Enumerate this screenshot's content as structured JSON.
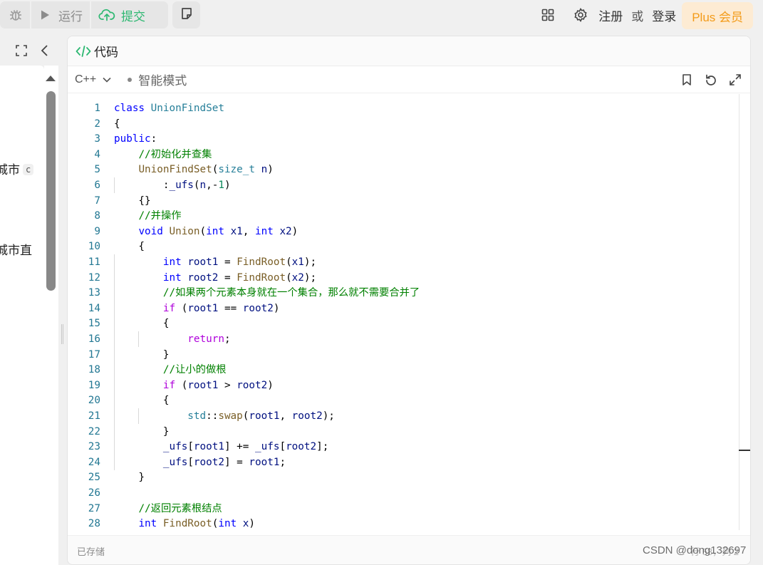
{
  "toolbar": {
    "run_label": "运行",
    "submit_label": "提交"
  },
  "header": {
    "register": "注册",
    "or": "或",
    "login": "登录",
    "plus": "Plus 会员"
  },
  "left_panel": {
    "snippet1": "城市",
    "snippet1_tag": "c",
    "snippet2": "城市直"
  },
  "editor": {
    "title": "代码",
    "language": "C++",
    "mode": "智能模式",
    "status_saved": "已存储",
    "cursor_position": "行 58，列 2"
  },
  "code_lines": [
    {
      "n": "1"
    },
    {
      "n": "2"
    },
    {
      "n": "3"
    },
    {
      "n": "4"
    },
    {
      "n": "5"
    },
    {
      "n": "6"
    },
    {
      "n": "7"
    },
    {
      "n": "8"
    },
    {
      "n": "9"
    },
    {
      "n": "10"
    },
    {
      "n": "11"
    },
    {
      "n": "12"
    },
    {
      "n": "13"
    },
    {
      "n": "14"
    },
    {
      "n": "15"
    },
    {
      "n": "16"
    },
    {
      "n": "17"
    },
    {
      "n": "18"
    },
    {
      "n": "19"
    },
    {
      "n": "20"
    },
    {
      "n": "21"
    },
    {
      "n": "22"
    },
    {
      "n": "23"
    },
    {
      "n": "24"
    },
    {
      "n": "25"
    },
    {
      "n": "26"
    },
    {
      "n": "27"
    },
    {
      "n": "28"
    }
  ],
  "code": [
    [
      [
        "kw",
        "class"
      ],
      [
        "",
        ""
      ],
      [
        "ty",
        " UnionFindSet"
      ]
    ],
    [
      [
        "",
        "{"
      ]
    ],
    [
      [
        "kw",
        "public"
      ],
      [
        "",
        ":"
      ]
    ],
    [
      [
        "",
        "    "
      ],
      [
        "cm",
        "//初始化并查集"
      ]
    ],
    [
      [
        "",
        "    "
      ],
      [
        "fn",
        "UnionFindSet"
      ],
      [
        "",
        "("
      ],
      [
        "ty",
        "size_t"
      ],
      [
        "",
        " "
      ],
      [
        "vr",
        "n"
      ],
      [
        "",
        ")"
      ]
    ],
    [
      [
        "",
        "        :"
      ],
      [
        "vr",
        "_ufs"
      ],
      [
        "",
        "("
      ],
      [
        "vr",
        "n"
      ],
      [
        "",
        ",-"
      ],
      [
        "num",
        "1"
      ],
      [
        "",
        ")"
      ]
    ],
    [
      [
        "",
        "    {}"
      ]
    ],
    [
      [
        "",
        "    "
      ],
      [
        "cm",
        "//并操作"
      ]
    ],
    [
      [
        "",
        "    "
      ],
      [
        "kw",
        "void"
      ],
      [
        "",
        " "
      ],
      [
        "fn",
        "Union"
      ],
      [
        "",
        "("
      ],
      [
        "kw",
        "int"
      ],
      [
        "",
        " "
      ],
      [
        "vr",
        "x1"
      ],
      [
        "",
        ", "
      ],
      [
        "kw",
        "int"
      ],
      [
        "",
        " "
      ],
      [
        "vr",
        "x2"
      ],
      [
        "",
        ")"
      ]
    ],
    [
      [
        "",
        "    {"
      ]
    ],
    [
      [
        "",
        "        "
      ],
      [
        "kw",
        "int"
      ],
      [
        "",
        " "
      ],
      [
        "vr",
        "root1"
      ],
      [
        "",
        " = "
      ],
      [
        "fn",
        "FindRoot"
      ],
      [
        "",
        "("
      ],
      [
        "vr",
        "x1"
      ],
      [
        "",
        ");"
      ]
    ],
    [
      [
        "",
        "        "
      ],
      [
        "kw",
        "int"
      ],
      [
        "",
        " "
      ],
      [
        "vr",
        "root2"
      ],
      [
        "",
        " = "
      ],
      [
        "fn",
        "FindRoot"
      ],
      [
        "",
        "("
      ],
      [
        "vr",
        "x2"
      ],
      [
        "",
        ");"
      ]
    ],
    [
      [
        "",
        "        "
      ],
      [
        "cm",
        "//如果两个元素本身就在一个集合，那么就不需要合并了"
      ]
    ],
    [
      [
        "",
        "        "
      ],
      [
        "kw2",
        "if"
      ],
      [
        "",
        " ("
      ],
      [
        "vr",
        "root1"
      ],
      [
        "",
        " == "
      ],
      [
        "vr",
        "root2"
      ],
      [
        "",
        ")"
      ]
    ],
    [
      [
        "",
        "        {"
      ]
    ],
    [
      [
        "",
        "            "
      ],
      [
        "kw2",
        "return"
      ],
      [
        "",
        ";"
      ]
    ],
    [
      [
        "",
        "        }"
      ]
    ],
    [
      [
        "",
        "        "
      ],
      [
        "cm",
        "//让小的做根"
      ]
    ],
    [
      [
        "",
        "        "
      ],
      [
        "kw2",
        "if"
      ],
      [
        "",
        " ("
      ],
      [
        "vr",
        "root1"
      ],
      [
        "",
        " > "
      ],
      [
        "vr",
        "root2"
      ],
      [
        "",
        ")"
      ]
    ],
    [
      [
        "",
        "        {"
      ]
    ],
    [
      [
        "",
        "            "
      ],
      [
        "ty",
        "std"
      ],
      [
        "",
        "::"
      ],
      [
        "fn",
        "swap"
      ],
      [
        "",
        "("
      ],
      [
        "vr",
        "root1"
      ],
      [
        "",
        ", "
      ],
      [
        "vr",
        "root2"
      ],
      [
        "",
        ");"
      ]
    ],
    [
      [
        "",
        "        }"
      ]
    ],
    [
      [
        "",
        "        "
      ],
      [
        "vr",
        "_ufs"
      ],
      [
        "",
        "["
      ],
      [
        "vr",
        "root1"
      ],
      [
        "",
        "] += "
      ],
      [
        "vr",
        "_ufs"
      ],
      [
        "",
        "["
      ],
      [
        "vr",
        "root2"
      ],
      [
        "",
        "];"
      ]
    ],
    [
      [
        "",
        "        "
      ],
      [
        "vr",
        "_ufs"
      ],
      [
        "",
        "["
      ],
      [
        "vr",
        "root2"
      ],
      [
        "",
        "] = "
      ],
      [
        "vr",
        "root1"
      ],
      [
        "",
        ";"
      ]
    ],
    [
      [
        "",
        "    }"
      ]
    ],
    [
      [
        "",
        ""
      ]
    ],
    [
      [
        "",
        "    "
      ],
      [
        "cm",
        "//返回元素根结点"
      ]
    ],
    [
      [
        "",
        "    "
      ],
      [
        "kw",
        "int"
      ],
      [
        "",
        " "
      ],
      [
        "fn",
        "FindRoot"
      ],
      [
        "",
        "("
      ],
      [
        "kw",
        "int"
      ],
      [
        "",
        " "
      ],
      [
        "vr",
        "x"
      ],
      [
        "",
        ")"
      ]
    ]
  ],
  "guides": [
    [],
    [],
    [],
    [],
    [],
    [
      1
    ],
    [],
    [],
    [],
    [],
    [
      1
    ],
    [
      1
    ],
    [
      1
    ],
    [
      1
    ],
    [
      1
    ],
    [
      1,
      2
    ],
    [
      1
    ],
    [
      1
    ],
    [
      1
    ],
    [
      1
    ],
    [
      1,
      2
    ],
    [
      1
    ],
    [
      1
    ],
    [
      1
    ],
    [],
    [],
    [],
    []
  ],
  "watermark": "CSDN @dong132697"
}
